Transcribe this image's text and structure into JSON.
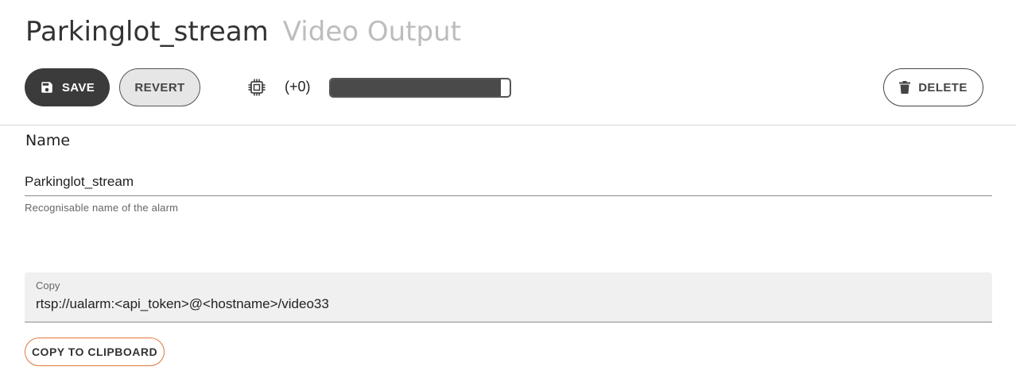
{
  "header": {
    "title": "Parkinglot_stream",
    "subtitle": "Video Output"
  },
  "toolbar": {
    "save_label": "SAVE",
    "revert_label": "REVERT",
    "delete_label": "DELETE",
    "counter_text": "(+0)",
    "progress_fraction": 0.95,
    "icons": {
      "save": "floppy-disk-icon",
      "resource": "cpu-chip-icon",
      "delete": "trash-icon"
    }
  },
  "name_field": {
    "section_label": "Name",
    "value": "Parkinglot_stream",
    "helper_text": "Recognisable name of the alarm"
  },
  "copy_field": {
    "label": "Copy",
    "value": "rtsp://ualarm:<api_token>@<hostname>/video33",
    "button_label": "COPY TO CLIPBOARD"
  },
  "colors": {
    "primary_dark": "#3b3b3b",
    "accent_orange": "#e0763a",
    "title_muted": "#bdbdbd",
    "field_bg": "#f0f0f0"
  }
}
